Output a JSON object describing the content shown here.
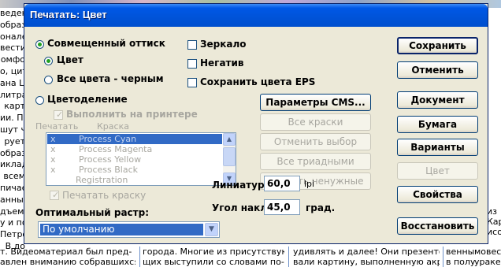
{
  "background": {
    "left_column": [
      "ведени",
      "образ",
      "онале",
      "вести",
      "омфо",
      "о, цит",
      "ана Ц",
      "литра",
      "карт",
      "ии. По",
      "шут ч",
      "рует",
      "образ",
      "иклад",
      "всем",
      "пичает",
      "анных",
      "дъем!",
      "у и по",
      "Петро",
      "В до"
    ],
    "right_edge": [
      "из",
      "Кар",
      "исо"
    ],
    "bottom_lines": [
      {
        "col1": "т. Видеоматериал был пред-",
        "col2": "города. Многие из присутствую-",
        "col3": "удивлять и далее! Они презенто-",
        "col4": "венны",
        "col5": "мовес"
      },
      {
        "col1": "авлен вниманию собравшихся и",
        "col2": "щих выступили со словами по-",
        "col3": "вали картину, выполненную акри-",
        "col4": "в полу",
        "col5": "ураке"
      }
    ]
  },
  "window": {
    "title": "Печатать: Цвет"
  },
  "options": {
    "composite_label": "Совмещенный оттиск",
    "color_label": "Цвет",
    "all_black_label": "Все цвета - черным",
    "separations_label": "Цветоделение",
    "mirror_label": "Зеркало",
    "negative_label": "Негатив",
    "save_eps_label": "Сохранить цвета EPS",
    "print_on_printer_label": "Выполнить на принтере",
    "print_color_label": "Печатать краску"
  },
  "list": {
    "header_print": "Печатать",
    "header_ink": "Краска",
    "rows": [
      {
        "mark": "x",
        "name": "Process Cyan",
        "selected": true
      },
      {
        "mark": "x",
        "name": "Process Magenta",
        "selected": false
      },
      {
        "mark": "x",
        "name": "Process Yellow",
        "selected": false
      },
      {
        "mark": "x",
        "name": "Process Black",
        "selected": false
      },
      {
        "mark": "",
        "name": "Registration",
        "selected": false
      }
    ]
  },
  "middle_buttons": {
    "cms": "Параметры CMS...",
    "all_inks": "Все краски",
    "deselect": "Отменить выбор",
    "all_triads": "Все триадными",
    "remove_unused": "Удалить ненужные"
  },
  "screen": {
    "label": "Оптимальный растр:",
    "value": "По умолчанию"
  },
  "lineature": {
    "label": "Линиатура:",
    "value": "60,0",
    "unit": "lpi"
  },
  "angle": {
    "label": "Угол наклона:",
    "value": "45,0",
    "unit": "град."
  },
  "right_buttons": {
    "save": "Сохранить",
    "cancel": "Отменить",
    "document": "Документ",
    "paper": "Бумага",
    "variants": "Варианты",
    "color": "Цвет",
    "properties": "Свойства",
    "restore": "Восстановить"
  }
}
